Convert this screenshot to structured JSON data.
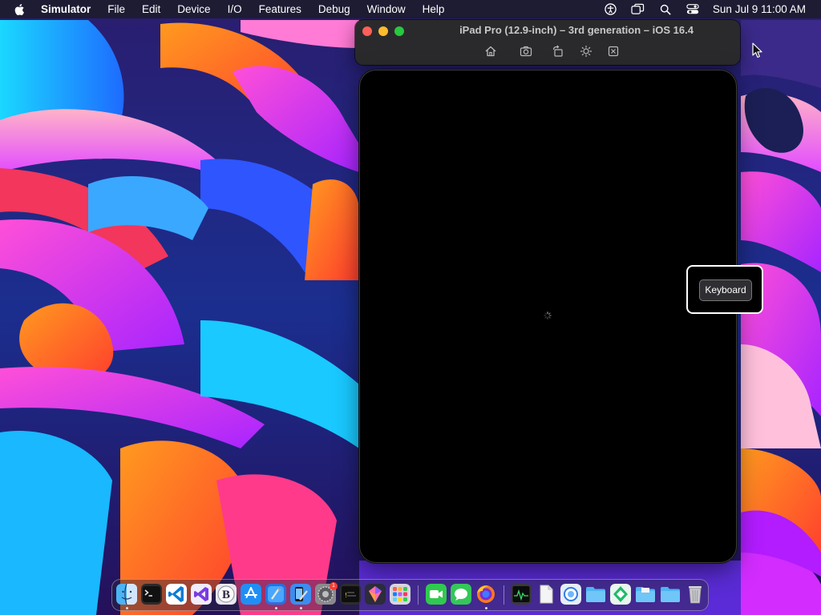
{
  "menubar": {
    "app_name": "Simulator",
    "items": [
      "File",
      "Edit",
      "Device",
      "I/O",
      "Features",
      "Debug",
      "Window",
      "Help"
    ],
    "status_icons": [
      "accessibility-icon",
      "window-switch-icon",
      "search-icon",
      "control-center-icon"
    ],
    "datetime": "Sun Jul 9  11:00 AM"
  },
  "simulator": {
    "title": "iPad Pro (12.9-inch) – 3rd generation – iOS 16.4",
    "toolbar_icons": [
      "home-icon",
      "screenshot-icon",
      "rotate-icon",
      "appearance-icon",
      "keyboard-toggle-icon"
    ],
    "screen_state": "loading"
  },
  "keyboard_popup": {
    "label": "Keyboard"
  },
  "dock": {
    "items": [
      {
        "name": "Finder",
        "icon": "finder-icon",
        "running": true
      },
      {
        "name": "Terminal",
        "icon": "terminal-icon",
        "running": false
      },
      {
        "name": "Visual Studio Code",
        "icon": "vscode-icon",
        "running": false
      },
      {
        "name": "Visual Studio",
        "icon": "visual-studio-icon",
        "running": false
      },
      {
        "name": "BBEdit",
        "icon": "bbedit-icon",
        "running": false
      },
      {
        "name": "App Store",
        "icon": "app-store-icon",
        "running": false
      },
      {
        "name": "Xcode",
        "icon": "xcode-icon",
        "running": true
      },
      {
        "name": "Simulator",
        "icon": "simulator-icon",
        "running": true
      },
      {
        "name": "System Settings",
        "icon": "system-settings-icon",
        "running": false,
        "badge": "1"
      },
      {
        "name": "Console",
        "icon": "console-icon",
        "running": false
      },
      {
        "name": "Sketch",
        "icon": "sketch-icon",
        "running": false
      },
      {
        "name": "Launchpad",
        "icon": "launchpad-icon",
        "running": false
      },
      {
        "name": "FaceTime",
        "icon": "facetime-icon",
        "running": false
      },
      {
        "name": "Messages",
        "icon": "messages-icon",
        "running": false
      },
      {
        "name": "Firefox",
        "icon": "firefox-icon",
        "running": true
      },
      {
        "name": "Activity Monitor",
        "icon": "activity-monitor-icon",
        "running": false
      },
      {
        "name": "Document",
        "icon": "document-icon",
        "running": false
      },
      {
        "name": "Preview",
        "icon": "preview-icon",
        "running": false
      },
      {
        "name": "Folder",
        "icon": "folder-icon",
        "running": false
      },
      {
        "name": "Xcode Cloud",
        "icon": "xcode-cloud-icon",
        "running": false
      },
      {
        "name": "Folder",
        "icon": "folder-icon",
        "running": false
      },
      {
        "name": "Downloads",
        "icon": "folder-icon",
        "running": false
      },
      {
        "name": "Trash",
        "icon": "trash-icon",
        "running": false
      }
    ]
  },
  "colors": {
    "menubar_bg": "#1c1c26",
    "window_bg": "#2a2a2c",
    "close": "#fe5f57",
    "minimize": "#febc2e",
    "maximize": "#28c840"
  }
}
